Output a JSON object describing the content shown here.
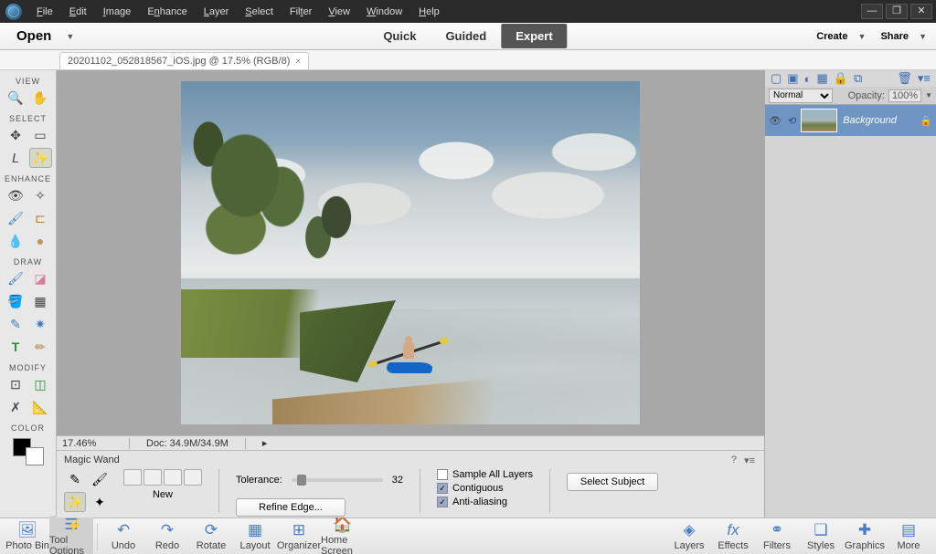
{
  "menu": {
    "file": "File",
    "edit": "Edit",
    "image": "Image",
    "enhance": "Enhance",
    "layer": "Layer",
    "select": "Select",
    "filter": "Filter",
    "view": "View",
    "window": "Window",
    "help": "Help"
  },
  "modebar": {
    "open": "Open",
    "quick": "Quick",
    "guided": "Guided",
    "expert": "Expert",
    "create": "Create",
    "share": "Share"
  },
  "doc_tab": "20201102_052818567_iOS.jpg @ 17.5% (RGB/8)",
  "toolbar": {
    "view": "VIEW",
    "select": "SELECT",
    "enhance": "ENHANCE",
    "draw": "DRAW",
    "modify": "MODIFY",
    "color": "COLOR"
  },
  "status": {
    "zoom": "17.46%",
    "doc": "Doc: 34.9M/34.9M"
  },
  "options": {
    "title": "Magic Wand",
    "new": "New",
    "tolerance_label": "Tolerance:",
    "tolerance_value": "32",
    "refine": "Refine Edge...",
    "sample_all": "Sample All Layers",
    "contiguous": "Contiguous",
    "antialias": "Anti-aliasing",
    "select_subject": "Select Subject"
  },
  "layers": {
    "mode": "Normal",
    "opacity_label": "Opacity:",
    "opacity_value": "100%",
    "background": "Background"
  },
  "taskbar": {
    "photo_bin": "Photo Bin",
    "tool_options": "Tool Options",
    "undo": "Undo",
    "redo": "Redo",
    "rotate": "Rotate",
    "layout": "Layout",
    "organizer": "Organizer",
    "home": "Home Screen",
    "layers": "Layers",
    "effects": "Effects",
    "filters": "Filters",
    "styles": "Styles",
    "graphics": "Graphics",
    "more": "More"
  }
}
